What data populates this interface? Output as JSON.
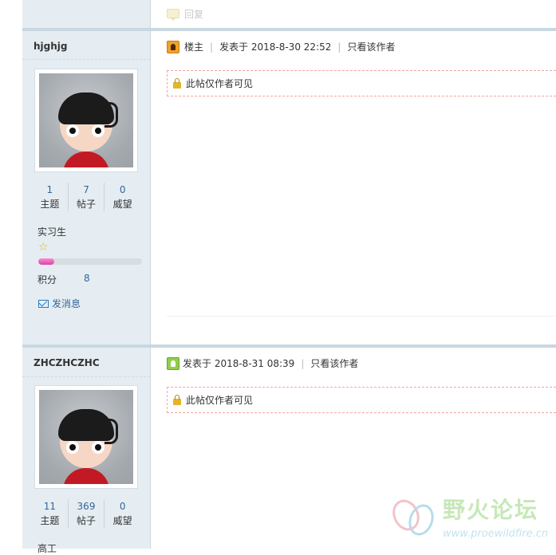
{
  "top": {
    "reply_label": "回复"
  },
  "posts": [
    {
      "username": "hjghjg",
      "stats": [
        {
          "value": "1",
          "label": "主题"
        },
        {
          "value": "7",
          "label": "帖子"
        },
        {
          "value": "0",
          "label": "威望"
        }
      ],
      "rank": "实习生",
      "progress_fraction": 0.15,
      "points_label": "积分",
      "points_value": "8",
      "message_label": "发消息",
      "owner_label": "楼主",
      "posted": "发表于 2018-8-30 22:52",
      "only_author": "只看该作者",
      "notice": "此帖仅作者可见"
    },
    {
      "username": "ZHCZHCZHC",
      "stats": [
        {
          "value": "11",
          "label": "主题"
        },
        {
          "value": "369",
          "label": "帖子"
        },
        {
          "value": "0",
          "label": "威望"
        }
      ],
      "rank": "高工",
      "posted": "发表于 2018-8-31 08:39",
      "only_author": "只看该作者",
      "notice": "此帖仅作者可见"
    }
  ],
  "watermark": {
    "title": "野火论坛",
    "url": "www.proewildfire.cn"
  }
}
